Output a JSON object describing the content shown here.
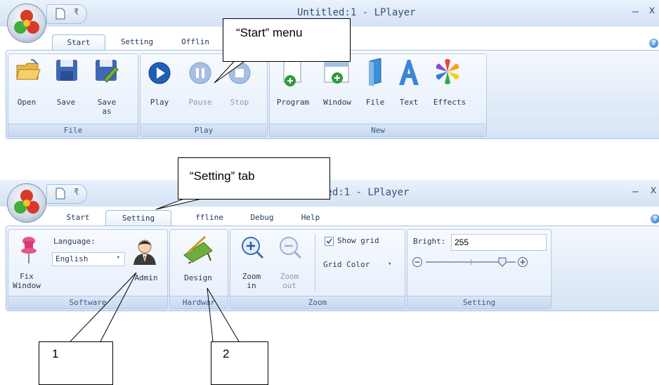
{
  "top": {
    "title": "Untitled:1 - LPlayer",
    "close_glyph": "x",
    "min_glyph": "–",
    "help_glyph": "?",
    "tabs": [
      {
        "label": "Start"
      },
      {
        "label": "Setting"
      },
      {
        "label": "Offlin"
      }
    ],
    "groups": {
      "file": {
        "label": "File",
        "buttons": [
          {
            "label": "Open"
          },
          {
            "label": "Save"
          },
          {
            "label": "Save as"
          }
        ]
      },
      "play": {
        "label": "Play",
        "buttons": [
          {
            "label": "Play"
          },
          {
            "label": "Pause"
          },
          {
            "label": "Stop"
          }
        ]
      },
      "new": {
        "label": "New",
        "buttons": [
          {
            "label": "Program"
          },
          {
            "label": "Window"
          },
          {
            "label": "File"
          },
          {
            "label": "Text"
          },
          {
            "label": "Effects"
          }
        ]
      }
    },
    "callout": "“Start” menu"
  },
  "bottom": {
    "title": "led:1 - LPlayer",
    "close_glyph": "x",
    "min_glyph": "–",
    "help_glyph": "?",
    "tabs": [
      {
        "label": "Start"
      },
      {
        "label": "Setting"
      },
      {
        "label": "ffline"
      },
      {
        "label": "Debug"
      },
      {
        "label": "Help"
      }
    ],
    "software": {
      "label": "Software",
      "fix_window": "Fix Window",
      "language_label": "Language:",
      "language_value": "English",
      "admin": "Admin"
    },
    "hardware": {
      "label": "Hardwar",
      "design": "Design"
    },
    "zoom": {
      "label": "Zoom",
      "zoom_in": "Zoom in",
      "zoom_out": "Zoom out",
      "show_grid": "Show grid",
      "show_grid_checked": true,
      "grid_color": "Grid Color"
    },
    "setting": {
      "label": "Setting",
      "bright_label": "Bright:",
      "bright_value": "255",
      "bright_level": 0.85
    },
    "callout": "“Setting” tab"
  },
  "annotations": {
    "one": "1",
    "two": "2"
  }
}
